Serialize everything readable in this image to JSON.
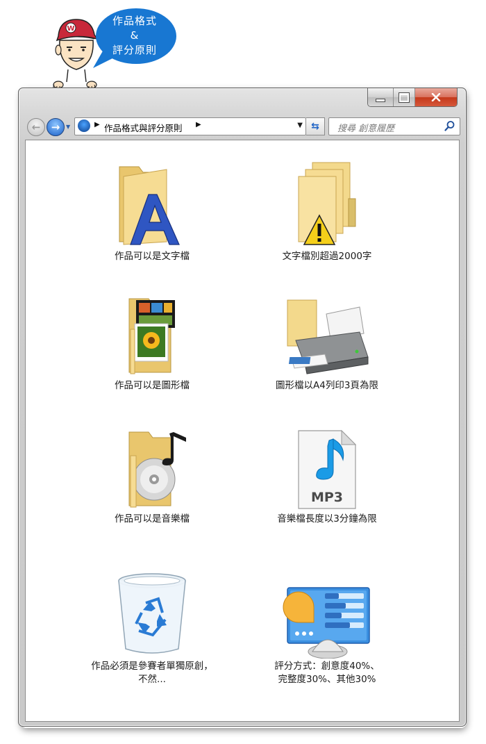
{
  "bubble": {
    "line1": "作品格式",
    "line2": "&",
    "line3": "評分原則"
  },
  "window": {
    "breadcrumb": "作品格式與評分原則",
    "search_placeholder": "搜尋  創意履歷",
    "caption": {
      "minimize": "—",
      "maximize": "□",
      "close": "X"
    }
  },
  "items": [
    {
      "label": "作品可以是文字檔",
      "icon": "text-folder-icon"
    },
    {
      "label": "文字檔別超過2000字",
      "icon": "warning-folder-icon"
    },
    {
      "label": "作品可以是圖形檔",
      "icon": "picture-folder-icon"
    },
    {
      "label": "圖形檔以A4列印3頁為限",
      "icon": "printer-icon"
    },
    {
      "label": "作品可以是音樂檔",
      "icon": "music-folder-icon"
    },
    {
      "label": "音樂檔長度以3分鐘為限",
      "icon": "mp3-file-icon",
      "badge": "MP3"
    },
    {
      "label_line1": "作品必須是參賽者單獨原創，",
      "label_line2": "不然...",
      "icon": "recycle-bin-icon"
    },
    {
      "label_line1": "評分方式：創意度40%、",
      "label_line2": "完整度30%、其他30%",
      "icon": "control-panel-icon"
    }
  ],
  "colors": {
    "bubble": "#1877d2",
    "folder": "#f3d98c",
    "accent": "#1e63c6",
    "close": "#c4391b"
  }
}
